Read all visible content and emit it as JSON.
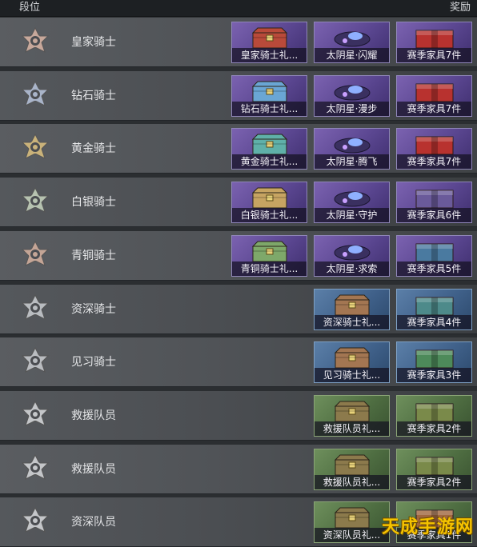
{
  "header": {
    "rank_label": "段位",
    "reward_label": "奖励"
  },
  "rows": [
    {
      "rank": "皇家骑士",
      "badge_color": "#c7a89b",
      "rewards": [
        {
          "label": "皇家骑士礼...",
          "type": "chest",
          "tone": "purple",
          "color": "#b94a3a"
        },
        {
          "label": "太阴星·闪耀",
          "type": "drone",
          "tone": "purple",
          "color": "#3a3060"
        },
        {
          "label": "赛季家具7件",
          "type": "crate",
          "tone": "purple",
          "color": "#b8322f"
        }
      ]
    },
    {
      "rank": "钻石骑士",
      "badge_color": "#a9b4c9",
      "rewards": [
        {
          "label": "钻石骑士礼...",
          "type": "chest",
          "tone": "purple",
          "color": "#6aa6d4"
        },
        {
          "label": "太阴星·漫步",
          "type": "drone",
          "tone": "purple",
          "color": "#3a3060"
        },
        {
          "label": "赛季家具7件",
          "type": "crate",
          "tone": "purple",
          "color": "#b8322f"
        }
      ]
    },
    {
      "rank": "黄金骑士",
      "badge_color": "#c9b27a",
      "rewards": [
        {
          "label": "黄金骑士礼...",
          "type": "chest",
          "tone": "purple",
          "color": "#5fb0a9"
        },
        {
          "label": "太阴星·腾飞",
          "type": "drone",
          "tone": "purple",
          "color": "#3a3060"
        },
        {
          "label": "赛季家具7件",
          "type": "crate",
          "tone": "purple",
          "color": "#b8322f"
        }
      ]
    },
    {
      "rank": "白银骑士",
      "badge_color": "#b6c2b0",
      "rewards": [
        {
          "label": "白银骑士礼...",
          "type": "chest",
          "tone": "purple",
          "color": "#c7a462"
        },
        {
          "label": "太阴星·守护",
          "type": "drone",
          "tone": "purple",
          "color": "#3a3060"
        },
        {
          "label": "赛季家具6件",
          "type": "crate",
          "tone": "purple",
          "color": "#6a5a9a"
        }
      ]
    },
    {
      "rank": "青铜骑士",
      "badge_color": "#c4a596",
      "rewards": [
        {
          "label": "青铜骑士礼...",
          "type": "chest",
          "tone": "purple",
          "color": "#7ea86a"
        },
        {
          "label": "太阴星·求索",
          "type": "drone",
          "tone": "purple",
          "color": "#3a3060"
        },
        {
          "label": "赛季家具5件",
          "type": "crate",
          "tone": "purple",
          "color": "#4a7aa0"
        }
      ]
    },
    {
      "rank": "资深骑士",
      "badge_color": "#b9bcc0",
      "rewards": [
        {
          "label": "资深骑士礼...",
          "type": "chest",
          "tone": "blue",
          "color": "#a37652"
        },
        {
          "label": "赛季家具4件",
          "type": "crate",
          "tone": "blue",
          "color": "#4d8a8a"
        }
      ]
    },
    {
      "rank": "见习骑士",
      "badge_color": "#b9bcc0",
      "rewards": [
        {
          "label": "见习骑士礼...",
          "type": "chest",
          "tone": "blue",
          "color": "#a37652"
        },
        {
          "label": "赛季家具3件",
          "type": "crate",
          "tone": "blue",
          "color": "#4d8a5a"
        }
      ]
    },
    {
      "rank": "救援队员",
      "badge_color": "#c4c6c9",
      "rewards": [
        {
          "label": "救援队员礼...",
          "type": "chest",
          "tone": "green",
          "color": "#8c7a4c"
        },
        {
          "label": "赛季家具2件",
          "type": "crate",
          "tone": "green",
          "color": "#7a8a4a"
        }
      ]
    },
    {
      "rank": "救援队员",
      "badge_color": "#c4c6c9",
      "rewards": [
        {
          "label": "救援队员礼...",
          "type": "chest",
          "tone": "green",
          "color": "#8c7a4c"
        },
        {
          "label": "赛季家具2件",
          "type": "crate",
          "tone": "green",
          "color": "#7a8a4a"
        }
      ]
    },
    {
      "rank": "资深队员",
      "badge_color": "#c4c6c9",
      "rewards": [
        {
          "label": "资深队员礼...",
          "type": "chest",
          "tone": "green",
          "color": "#8c7a4c"
        },
        {
          "label": "赛季家具1件",
          "type": "crate",
          "tone": "green",
          "color": "#a0673f"
        }
      ]
    }
  ],
  "watermark": "天成手游网"
}
